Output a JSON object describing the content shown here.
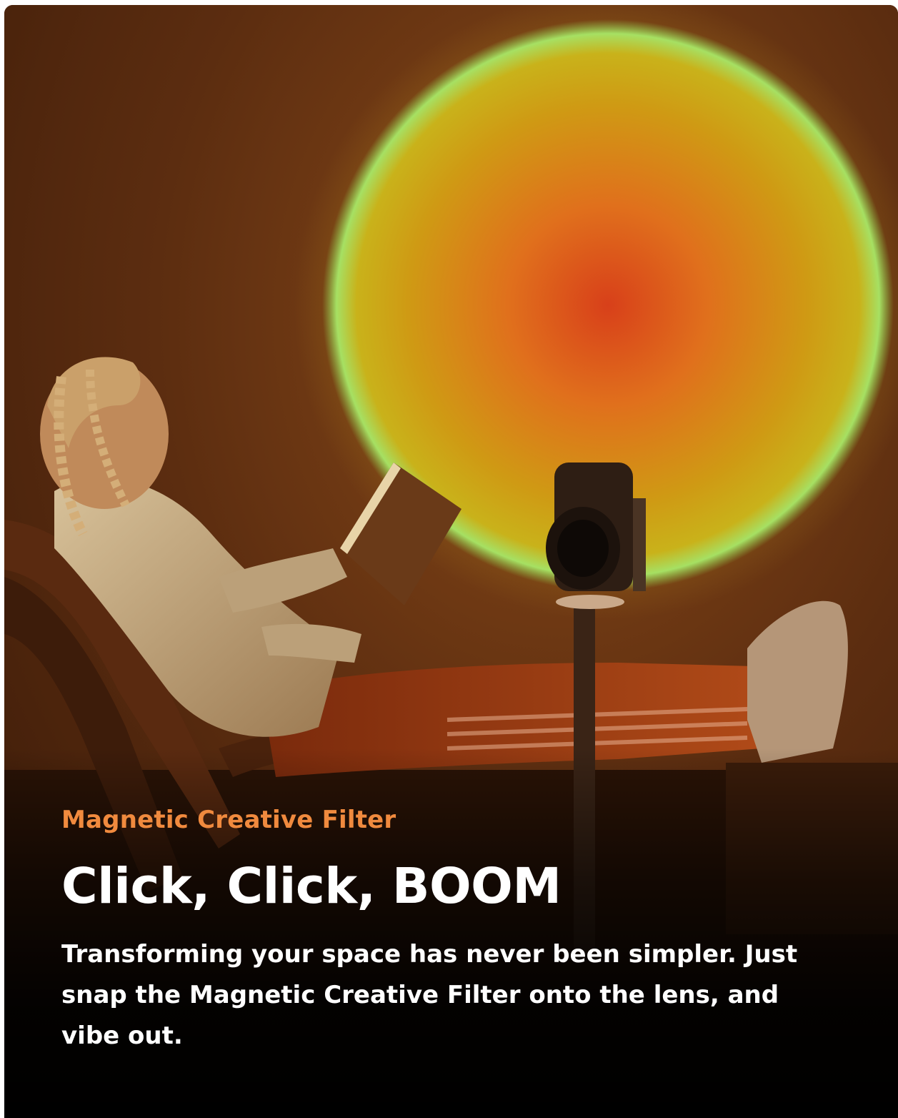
{
  "card": {
    "eyebrow": "Magnetic Creative Filter",
    "headline": "Click, Click, BOOM",
    "body": "Transforming your space has never been simpler. Just snap the Magnetic Creative Filter onto the lens, and vibe out."
  },
  "image": {
    "subject": "woman-reading-with-projector-sunset-glow"
  },
  "colors": {
    "accent": "#f08a3e",
    "headline": "#ffffff",
    "body": "#ffffff",
    "background_top": "#5a2c12",
    "background_bottom": "#000000",
    "halo_ring": "#9be05a",
    "halo_core": "#e25a18"
  }
}
